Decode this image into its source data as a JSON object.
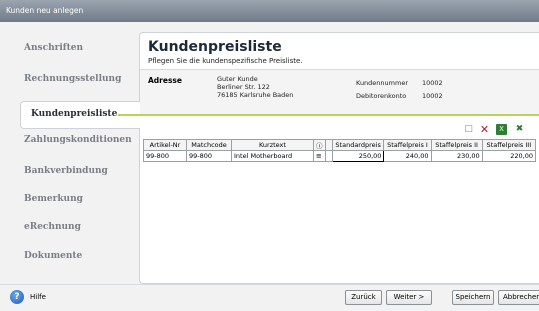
{
  "window": {
    "title": "Kunden neu anlegen"
  },
  "sidebar": {
    "items": [
      {
        "label": "Anschriften"
      },
      {
        "label": "Rechnungsstellung"
      },
      {
        "label": "Kundenpreisliste"
      },
      {
        "label": "Zahlungskonditionen"
      },
      {
        "label": "Bankverbindung"
      },
      {
        "label": "Bemerkung"
      },
      {
        "label": "eRechnung"
      },
      {
        "label": "Dokumente"
      }
    ],
    "active": "Kundenpreisliste"
  },
  "page": {
    "title": "Kundenpreisliste",
    "subtitle": "Pflegen Sie die kundenspezifische Preisliste."
  },
  "address": {
    "label": "Adresse",
    "lines": [
      "Guter Kunde",
      "Berliner Str. 122",
      "76185 Karlsruhe Baden"
    ],
    "customer_number_label": "Kundennummer",
    "customer_number": "10002",
    "debtor_account_label": "Debitorenkonto",
    "debtor_account": "10002"
  },
  "toolbar": {
    "icons": [
      "new-icon",
      "delete-icon",
      "excel-icon",
      "export-icon"
    ],
    "delete_color": "#c8102e",
    "excel_color": "#2e7d32"
  },
  "table": {
    "headers": [
      "Artikel-Nr",
      "Matchcode",
      "Kurztext",
      "",
      "",
      "Standardpreis",
      "Staffelpreis I",
      "Staffelpreis II",
      "Staffelpreis III"
    ],
    "rows": [
      [
        "99-800",
        "99-800",
        "Intel Motherboard",
        "",
        "",
        "250,00",
        "240,00",
        "230,00",
        "220,00"
      ]
    ]
  },
  "footer": {
    "help_label": "Hilfe",
    "back_label": "Zurück",
    "next_label": "Weiter >",
    "save_label": "Speichern",
    "cancel_label": "Abbrechen"
  },
  "colors": {
    "accent": "#b9d35a",
    "title": "#1b2a3a"
  }
}
